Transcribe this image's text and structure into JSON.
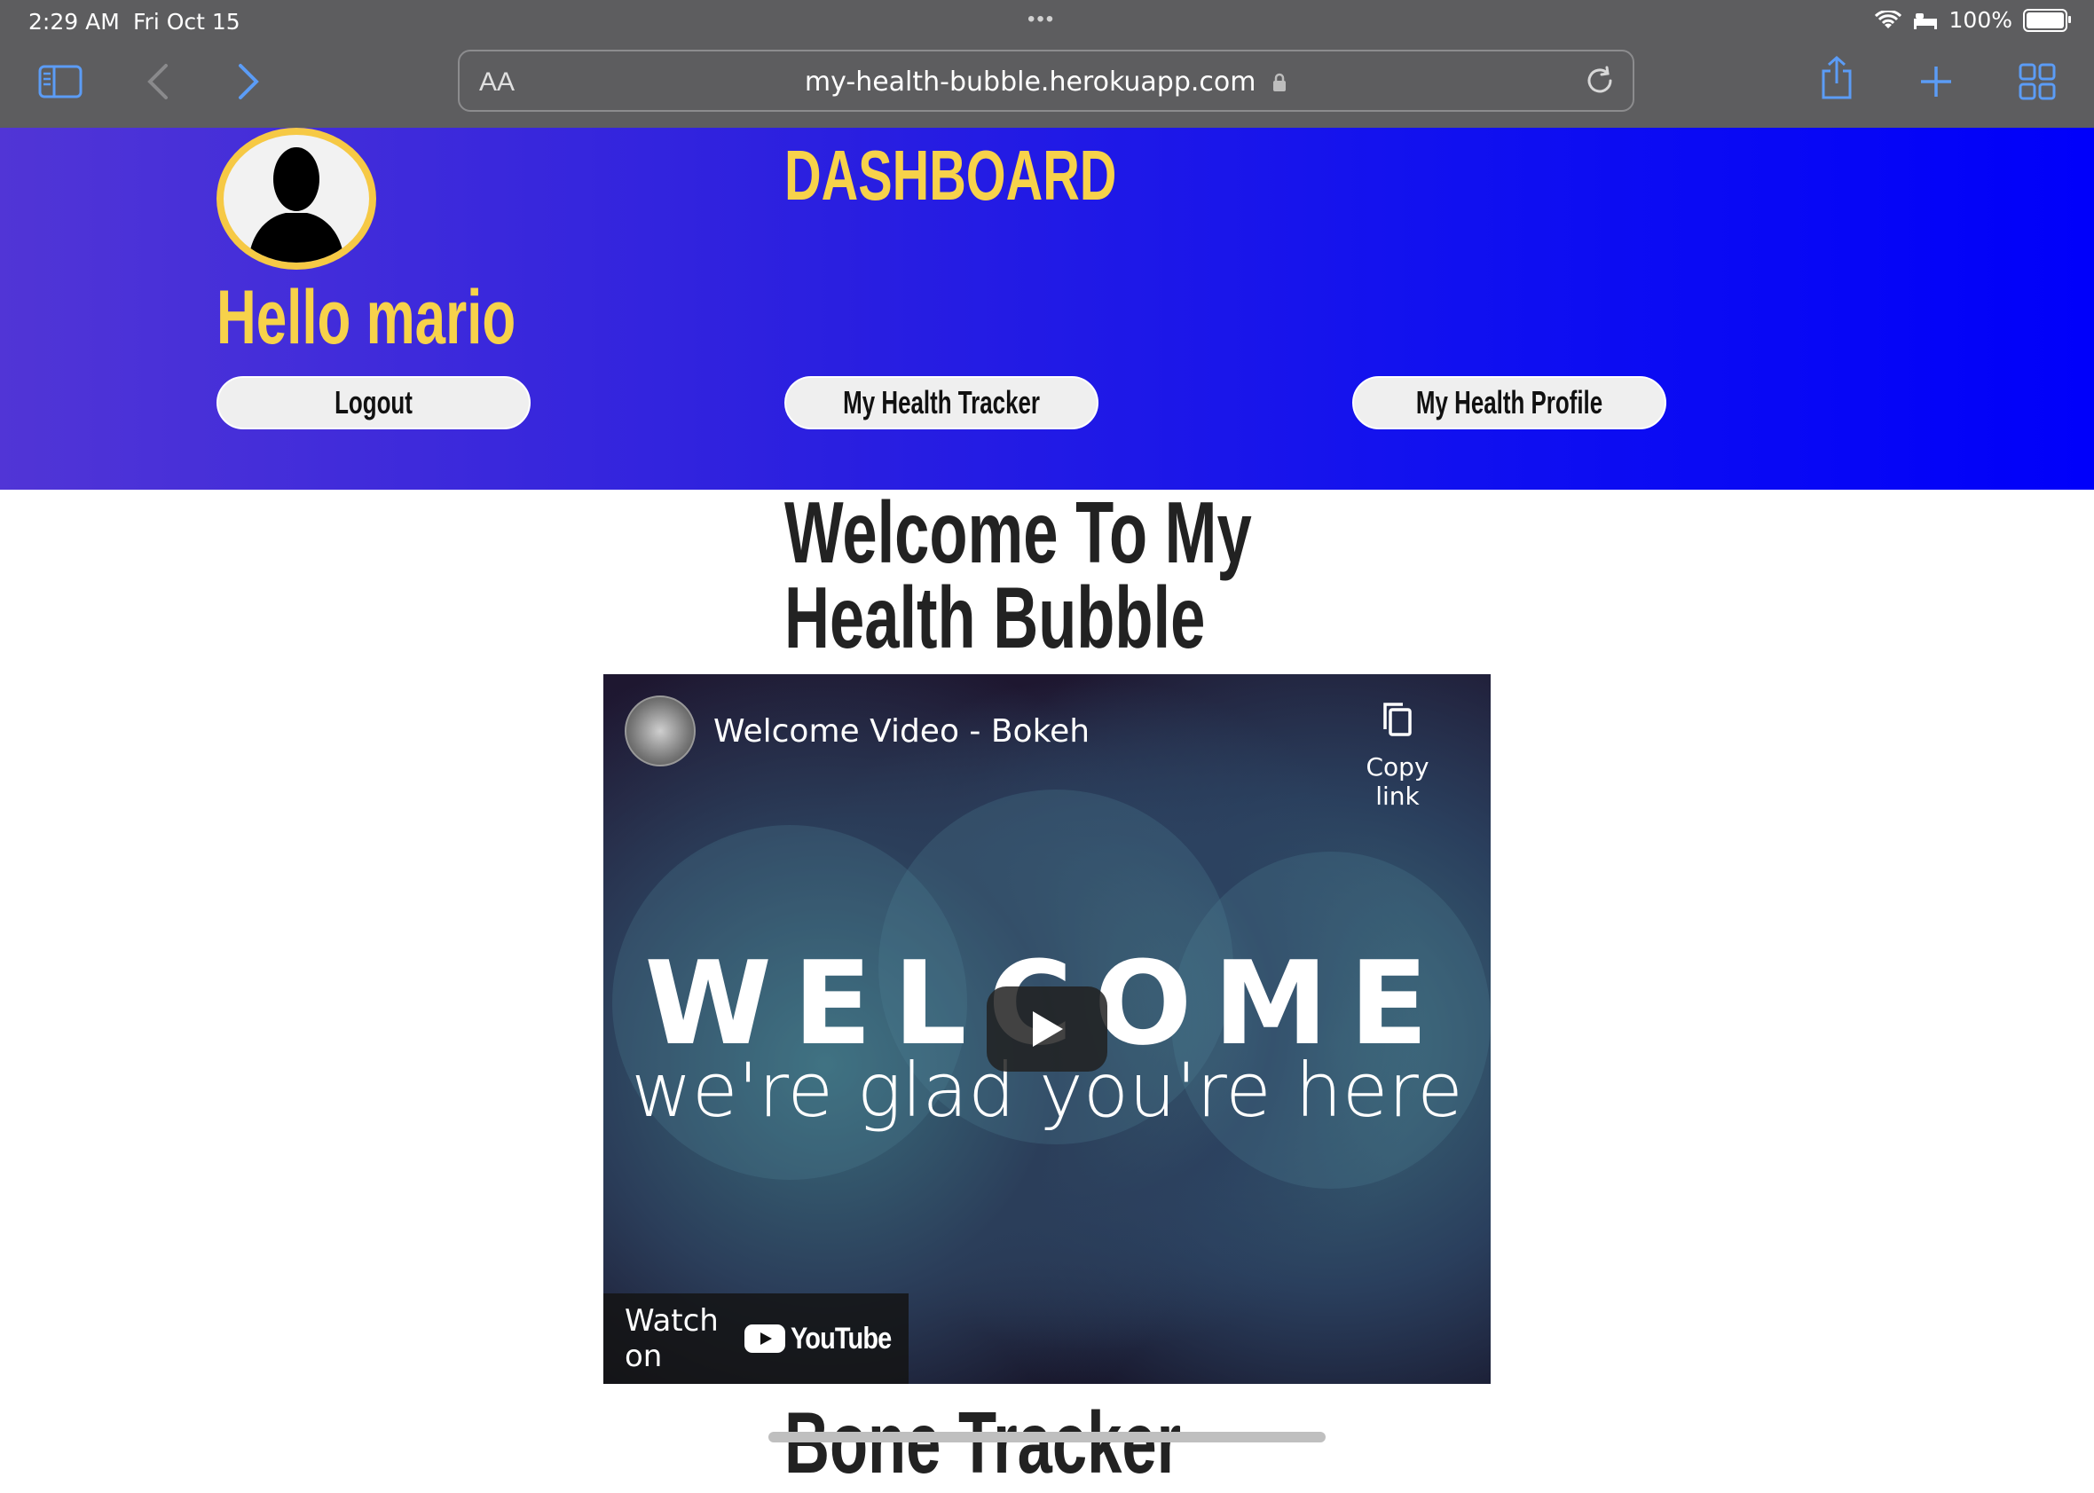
{
  "status_bar": {
    "time": "2:29 AM",
    "date": "Fri Oct 15",
    "battery": "100%"
  },
  "browser": {
    "text_size_label": "AA",
    "url": "my-health-bubble.herokuapp.com",
    "icons": [
      "sidebar-icon",
      "back-icon",
      "forward-icon",
      "lock-icon",
      "reload-icon",
      "share-icon",
      "new-tab-icon",
      "tabs-overview-icon"
    ]
  },
  "header": {
    "greeting": "Hello mario",
    "title": "DASHBOARD",
    "buttons": {
      "logout": "Logout",
      "tracker": "My Health Tracker",
      "profile": "My Health Profile"
    },
    "colors": {
      "accent": "#f7d24a",
      "gradient_start": "#5135d6",
      "gradient_end": "#0000fa"
    }
  },
  "main": {
    "welcome_line1": "Welcome To My",
    "welcome_line2": "Health Bubble",
    "video": {
      "title": "Welcome Video - Bokeh",
      "copy_link": "Copy link",
      "big_text": "WELCOME",
      "sub_text": "we're glad you're here",
      "watch_on": "Watch on",
      "platform": "YouTube"
    },
    "next_section_title": "Bone Tracker"
  }
}
